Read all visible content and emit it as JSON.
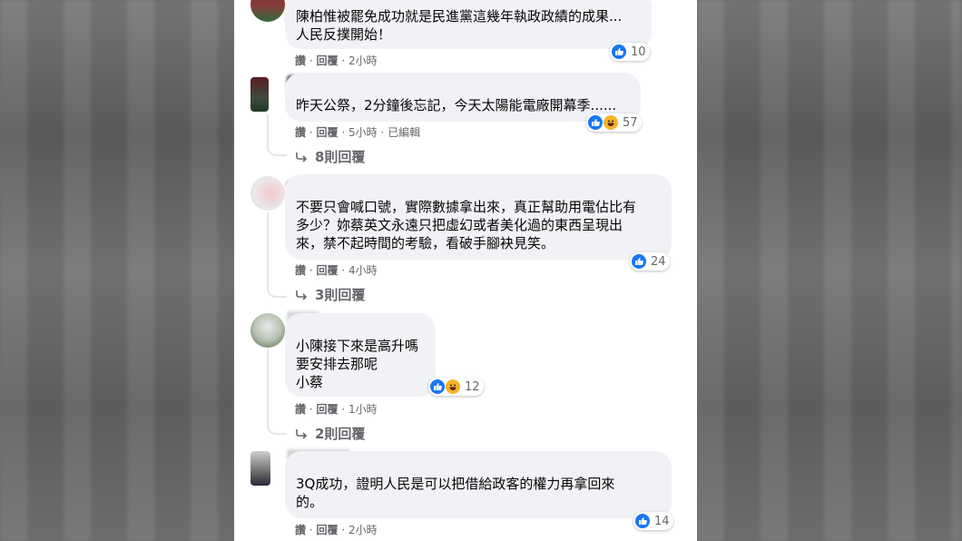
{
  "comments": [
    {
      "text": "陳柏惟被罷免成功就是民進黨這幾年執政政績的成果...\n人民反撲開始！",
      "actions": {
        "like": "讚",
        "reply": "回覆",
        "time": "2小時",
        "extra": ""
      },
      "reactions": {
        "count": "10",
        "icons": [
          "like-icon"
        ]
      },
      "replies": ""
    },
    {
      "text": "昨天公祭，2分鐘後忘記，今天太陽能電廠開幕季......",
      "actions": {
        "like": "讚",
        "reply": "回覆",
        "time": "5小時",
        "extra": "已編輯"
      },
      "reactions": {
        "count": "57",
        "icons": [
          "like-icon",
          "haha-icon"
        ]
      },
      "replies": "8則回覆"
    },
    {
      "text": "不要只會喊口號，實際數據拿出來，真正幫助用電佔比有\n多少？妳蔡英文永遠只把虛幻或者美化過的東西呈現出\n來，禁不起時間的考驗，看破手腳袂見笑。",
      "actions": {
        "like": "讚",
        "reply": "回覆",
        "time": "4小時",
        "extra": ""
      },
      "reactions": {
        "count": "24",
        "icons": [
          "like-icon"
        ]
      },
      "replies": "3則回覆"
    },
    {
      "text": "小陳接下來是高升嗎\n要安排去那呢\n小蔡",
      "actions": {
        "like": "讚",
        "reply": "回覆",
        "time": "1小時",
        "extra": ""
      },
      "reactions": {
        "count": "12",
        "icons": [
          "like-icon",
          "haha-icon"
        ]
      },
      "replies": "2則回覆"
    },
    {
      "text": "3Q成功，證明人民是可以把借給政客的權力再拿回來\n的。",
      "actions": {
        "like": "讚",
        "reply": "回覆",
        "time": "2小時",
        "extra": ""
      },
      "reactions": {
        "count": "14",
        "icons": [
          "like-icon"
        ]
      },
      "replies": ""
    }
  ],
  "colors": {
    "bubble": "#f0f2f5",
    "meta_text": "#65676b",
    "like_blue": "#1877f2",
    "haha_yellow": "#f7b125"
  }
}
